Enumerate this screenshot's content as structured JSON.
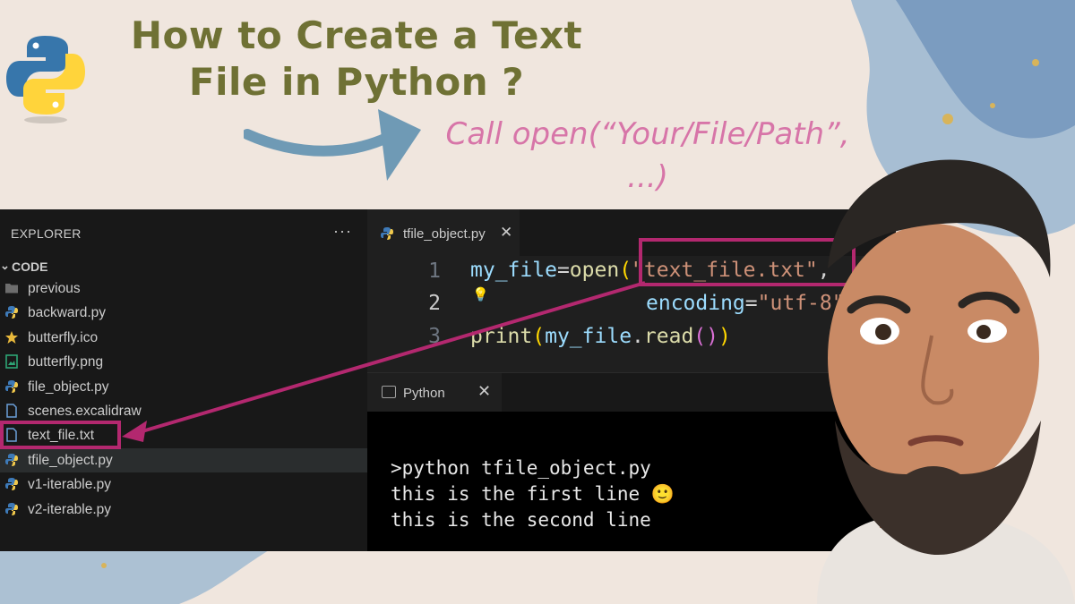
{
  "heading": {
    "line1": "How to Create a Text",
    "line2": "File in Python ?"
  },
  "callout": {
    "line1": "Call open(“Your/File/Path”,",
    "line2": "...)"
  },
  "explorer": {
    "title": "EXPLORER",
    "more": "···",
    "section": "CODE",
    "files": [
      {
        "name": "previous",
        "icon": "folder-icon"
      },
      {
        "name": "backward.py",
        "icon": "python-file-icon"
      },
      {
        "name": "butterfly.ico",
        "icon": "star-icon"
      },
      {
        "name": "butterfly.png",
        "icon": "image-file-icon"
      },
      {
        "name": "file_object.py",
        "icon": "python-file-icon"
      },
      {
        "name": "scenes.excalidraw",
        "icon": "file-icon"
      },
      {
        "name": "text_file.txt",
        "icon": "file-icon"
      },
      {
        "name": "tfile_object.py",
        "icon": "python-file-icon"
      },
      {
        "name": "v1-iterable.py",
        "icon": "python-file-icon"
      },
      {
        "name": "v2-iterable.py",
        "icon": "python-file-icon"
      }
    ]
  },
  "editor": {
    "tab": {
      "label": "tfile_object.py",
      "close": "✕"
    },
    "lines": [
      {
        "number": "1",
        "var": "my_file",
        "eq": "=",
        "fn": "open",
        "open": "(",
        "str": "\"text_file.txt\"",
        "comma": ","
      },
      {
        "number": "2",
        "param": "encoding",
        "eq": "=",
        "str": "\"utf-8\"",
        "close": ")"
      },
      {
        "number": "3",
        "fn": "print",
        "open": "(",
        "var": "my_file",
        "dot": ".",
        "method": "read",
        "parens": "()",
        "close": ")"
      }
    ]
  },
  "terminal": {
    "tab": {
      "label": "Python",
      "close": "✕"
    },
    "lines": [
      ">python tfile_object.py",
      "this is the first line 🙂",
      "this is the second line"
    ]
  },
  "colors": {
    "accent_highlight": "#b3286f",
    "title_color": "#6f7134",
    "callout_color": "#d775a8",
    "arrow_color": "#6f9ab5"
  }
}
